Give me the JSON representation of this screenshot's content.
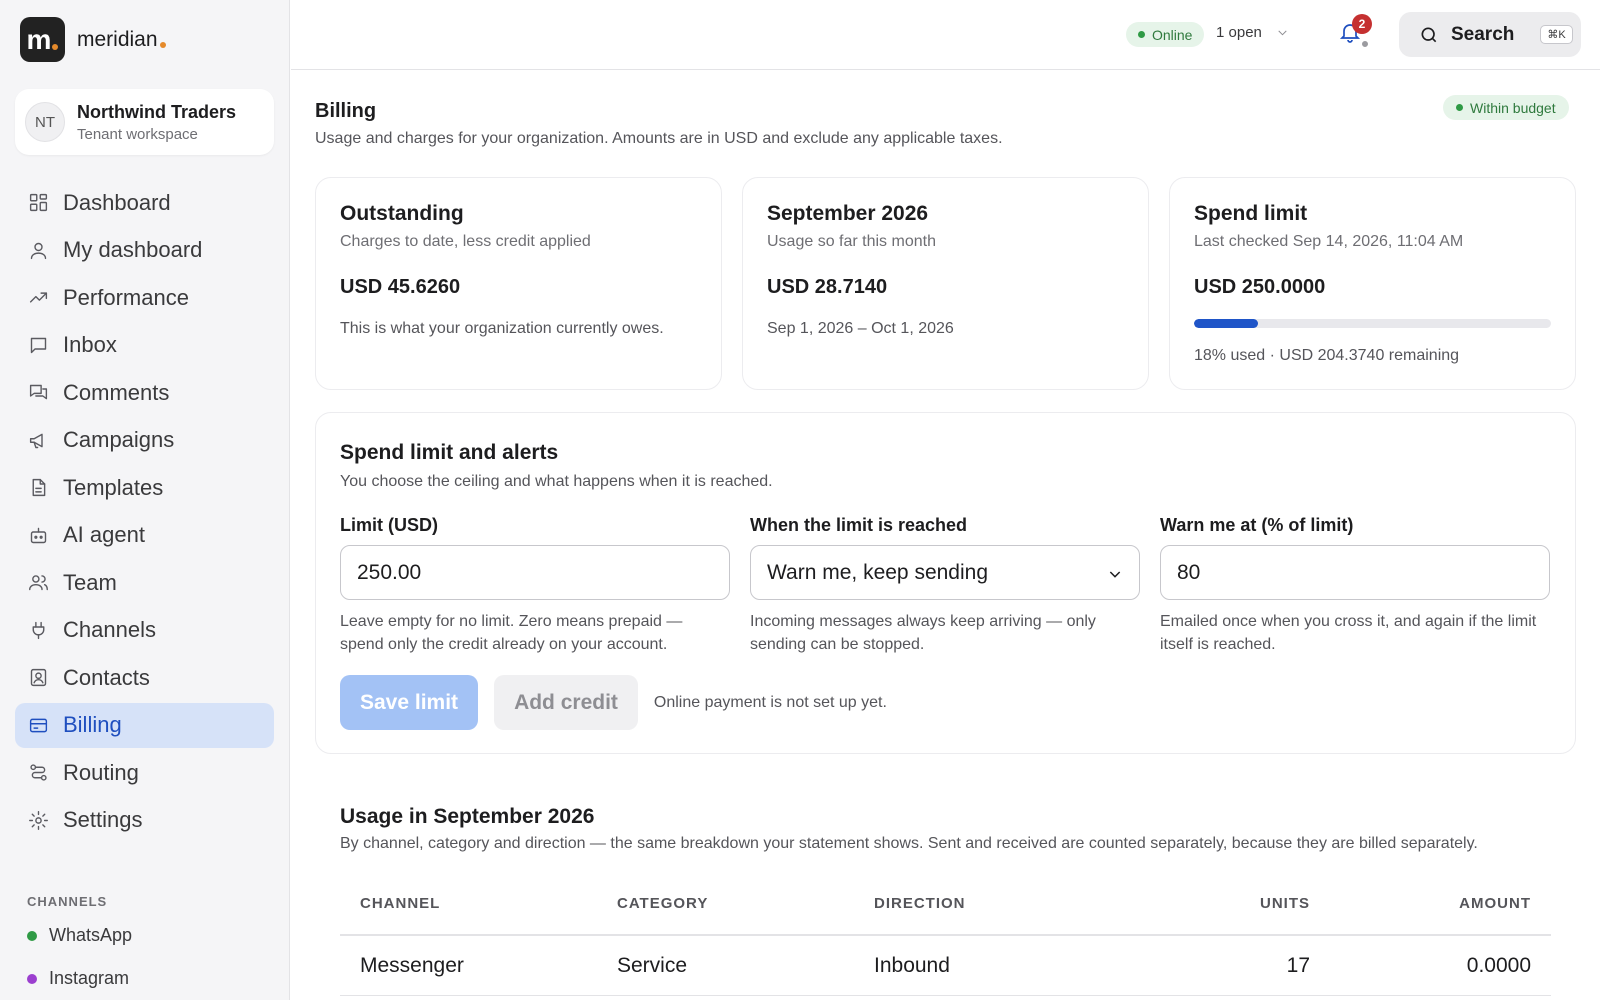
{
  "brand": {
    "logo_letter": "m",
    "name": "meridian"
  },
  "tenant": {
    "initials": "NT",
    "name": "Northwind Traders",
    "subtitle": "Tenant workspace"
  },
  "nav": [
    {
      "label": "Dashboard",
      "icon": "dashboard-icon"
    },
    {
      "label": "My dashboard",
      "icon": "user-icon"
    },
    {
      "label": "Performance",
      "icon": "trend-icon"
    },
    {
      "label": "Inbox",
      "icon": "chat-icon"
    },
    {
      "label": "Comments",
      "icon": "comments-icon"
    },
    {
      "label": "Campaigns",
      "icon": "megaphone-icon"
    },
    {
      "label": "Templates",
      "icon": "document-icon"
    },
    {
      "label": "AI agent",
      "icon": "robot-icon"
    },
    {
      "label": "Team",
      "icon": "team-icon"
    },
    {
      "label": "Channels",
      "icon": "plug-icon"
    },
    {
      "label": "Contacts",
      "icon": "contact-card-icon"
    },
    {
      "label": "Billing",
      "icon": "credit-card-icon",
      "active": true
    },
    {
      "label": "Routing",
      "icon": "routing-icon"
    },
    {
      "label": "Settings",
      "icon": "gear-icon"
    }
  ],
  "channels": {
    "heading": "CHANNELS",
    "items": [
      {
        "label": "WhatsApp",
        "color": "#2f9a45"
      },
      {
        "label": "Instagram",
        "color": "#9b3fcf"
      }
    ]
  },
  "topbar": {
    "status": "Online",
    "open_count": "1 open",
    "notifications": "2",
    "search_label": "Search",
    "search_shortcut": "⌘K"
  },
  "page": {
    "title": "Billing",
    "subtitle": "Usage and charges for your organization. Amounts are in USD and exclude any applicable taxes.",
    "budget_status": "Within budget"
  },
  "cards": [
    {
      "title": "Outstanding",
      "subtitle": "Charges to date, less credit applied",
      "amount": "USD 45.6260",
      "note": "This is what your organization currently owes."
    },
    {
      "title": "September 2026",
      "subtitle": "Usage so far this month",
      "amount": "USD 28.7140",
      "note": "Sep 1, 2026 – Oct 1, 2026"
    },
    {
      "title": "Spend limit",
      "subtitle": "Last checked Sep 14, 2026, 11:04 AM",
      "amount": "USD 250.0000",
      "progress_percent": 18,
      "note": "18% used · USD 204.3740 remaining"
    }
  ],
  "spend_panel": {
    "title": "Spend limit and alerts",
    "subtitle": "You choose the ceiling and what happens when it is reached.",
    "fields": [
      {
        "label": "Limit (USD)",
        "value": "250.00",
        "help": "Leave empty for no limit. Zero means prepaid — spend only the credit already on your account."
      },
      {
        "label": "When the limit is reached",
        "value": "Warn me, keep sending",
        "help": "Incoming messages always keep arriving — only sending can be stopped."
      },
      {
        "label": "Warn me at (% of limit)",
        "value": "80",
        "help": "Emailed once when you cross it, and again if the limit itself is reached."
      }
    ],
    "save_label": "Save limit",
    "credit_label": "Add credit",
    "payment_note": "Online payment is not set up yet."
  },
  "usage": {
    "title": "Usage in September 2026",
    "subtitle": "By channel, category and direction — the same breakdown your statement shows. Sent and received are counted separately, because they are billed separately.",
    "columns": [
      "CHANNEL",
      "CATEGORY",
      "DIRECTION",
      "UNITS",
      "AMOUNT"
    ],
    "rows": [
      {
        "channel": "Messenger",
        "category": "Service",
        "direction": "Inbound",
        "units": "17",
        "amount": "0.0000"
      }
    ]
  },
  "colors": {
    "accent": "#1f4fbf",
    "active_bg": "#d6e2f8",
    "success": "#2f9a45",
    "danger": "#c53030"
  }
}
